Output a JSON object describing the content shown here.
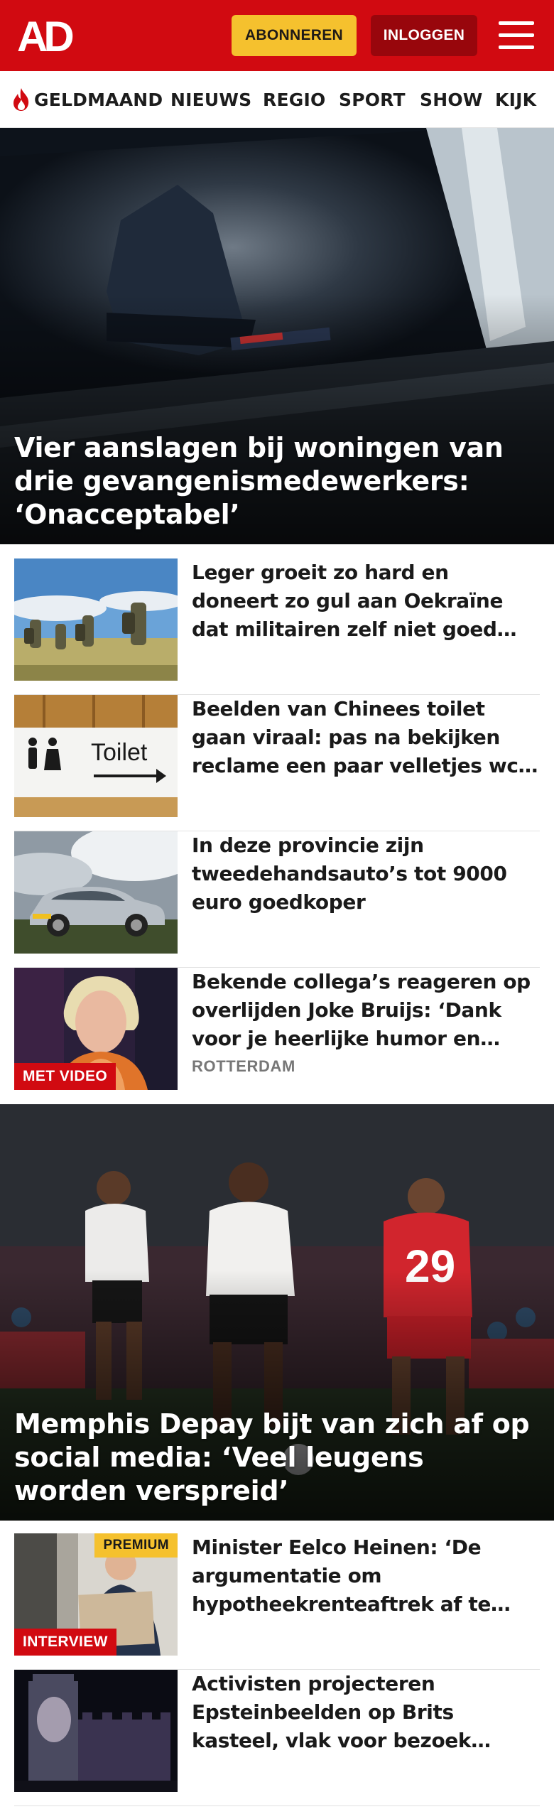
{
  "header": {
    "logo_text": "AD",
    "subscribe_label": "ABONNEREN",
    "login_label": "INLOGGEN",
    "menu_icon": "hamburger-menu-icon",
    "colors": {
      "brand_red": "#d10a11",
      "subscribe_yellow": "#f5c12e",
      "login_dark_red": "#98060c"
    }
  },
  "nav": {
    "items": [
      {
        "label": "GELDMAAND",
        "icon": "flame-icon"
      },
      {
        "label": "NIEUWS"
      },
      {
        "label": "REGIO"
      },
      {
        "label": "SPORT"
      },
      {
        "label": "SHOW"
      },
      {
        "label": "KIJK"
      }
    ]
  },
  "articles": {
    "hero1": {
      "title": "Vier aanslagen bij woningen van drie gevangenismedewerkers: ‘Onacceptabel’"
    },
    "list1": [
      {
        "title": "Leger groeit zo hard en doneert zo gul aan Oekraïne dat militairen zelf niet goed kunnen oefenen"
      },
      {
        "title": "Beelden van Chinees toilet gaan viraal: pas na bekijken reclame een paar velletjes wc-papier",
        "thumb_text": "Toilet"
      },
      {
        "title": "In deze provincie zijn tweedehandsauto’s tot 9000 euro goedkoper"
      },
      {
        "title": "Bekende collega’s reageren op overlijden Joke Bruijs: ‘Dank voor je heerlijke humor en mooie liedjes’",
        "region": "ROTTERDAM",
        "badge": "MET VIDEO"
      }
    ],
    "hero2": {
      "title": "Memphis Depay bijt van zich af op social media: ‘Veel leugens worden verspreid’",
      "shirt_number": "29"
    },
    "list2": [
      {
        "title": "Minister Eelco Heinen: ‘De argumentatie om hypotheekrenteaftrek af te schaffen rammelt’",
        "badge": "INTERVIEW",
        "premium": "PREMIUM"
      },
      {
        "title": "Activisten projecteren Epsteinbeelden op Brits kasteel, vlak voor bezoek Trump"
      }
    ]
  }
}
